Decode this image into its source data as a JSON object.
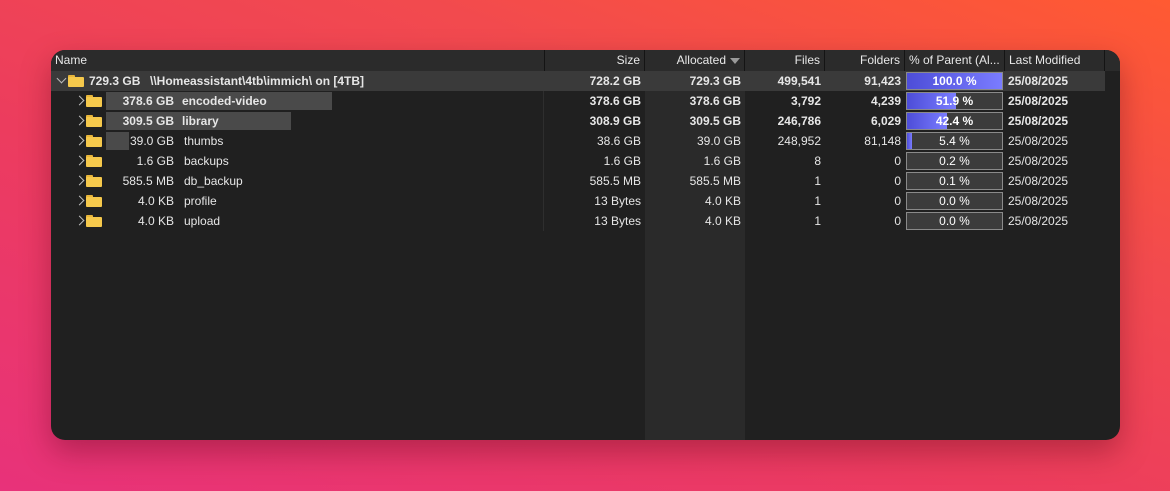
{
  "header": {
    "name": "Name",
    "size": "Size",
    "allocated": "Allocated",
    "files": "Files",
    "folders": "Folders",
    "percent": "% of Parent (Al...",
    "modified": "Last Modified"
  },
  "rows": [
    {
      "bar_label": "729.3 GB",
      "name": "\\\\Homeassistant\\4tb\\immich\\  on  [4TB]",
      "size": "728.2 GB",
      "allocated": "729.3 GB",
      "files": "499,541",
      "folders": "91,423",
      "percent": "100.0 %",
      "percent_value": 100.0,
      "bar_fraction": 1.0,
      "modified": "25/08/2025",
      "bold": true,
      "expanded": true
    },
    {
      "bar_label": "378.6 GB",
      "name": "encoded-video",
      "size": "378.6 GB",
      "allocated": "378.6 GB",
      "files": "3,792",
      "folders": "4,239",
      "percent": "51.9 %",
      "percent_value": 51.9,
      "bar_fraction": 1.0,
      "modified": "25/08/2025",
      "bold": true
    },
    {
      "bar_label": "309.5 GB",
      "name": "library",
      "size": "308.9 GB",
      "allocated": "309.5 GB",
      "files": "246,786",
      "folders": "6,029",
      "percent": "42.4 %",
      "percent_value": 42.4,
      "bar_fraction": 0.817,
      "modified": "25/08/2025",
      "bold": true
    },
    {
      "bar_label": "39.0 GB",
      "name": "thumbs",
      "size": "38.6 GB",
      "allocated": "39.0 GB",
      "files": "248,952",
      "folders": "81,148",
      "percent": "5.4 %",
      "percent_value": 5.4,
      "bar_fraction": 0.103,
      "modified": "25/08/2025",
      "bold": false
    },
    {
      "bar_label": "1.6 GB",
      "name": "backups",
      "size": "1.6 GB",
      "allocated": "1.6 GB",
      "files": "8",
      "folders": "0",
      "percent": "0.2 %",
      "percent_value": 0.2,
      "bar_fraction": 0.0,
      "modified": "25/08/2025",
      "bold": false
    },
    {
      "bar_label": "585.5 MB",
      "name": "db_backup",
      "size": "585.5 MB",
      "allocated": "585.5 MB",
      "files": "1",
      "folders": "0",
      "percent": "0.1 %",
      "percent_value": 0.1,
      "bar_fraction": 0.0,
      "modified": "25/08/2025",
      "bold": false
    },
    {
      "bar_label": "4.0 KB",
      "name": "profile",
      "size": "13 Bytes",
      "allocated": "4.0 KB",
      "files": "1",
      "folders": "0",
      "percent": "0.0 %",
      "percent_value": 0.0,
      "bar_fraction": 0.0,
      "modified": "25/08/2025",
      "bold": false
    },
    {
      "bar_label": "4.0 KB",
      "name": "upload",
      "size": "13 Bytes",
      "allocated": "4.0 KB",
      "files": "1",
      "folders": "0",
      "percent": "0.0 %",
      "percent_value": 0.0,
      "bar_fraction": 0.0,
      "modified": "25/08/2025",
      "bold": false
    }
  ],
  "icons": {
    "folder": "folder-icon",
    "expand": "chevron-right-icon",
    "collapse": "chevron-down-icon",
    "sort": "sort-descending-icon"
  },
  "colors": {
    "percent_fill": "#6a6cf5",
    "folder": "#f6c94c",
    "background_top": "#ff5a32",
    "background_bottom": "#e8327a"
  }
}
